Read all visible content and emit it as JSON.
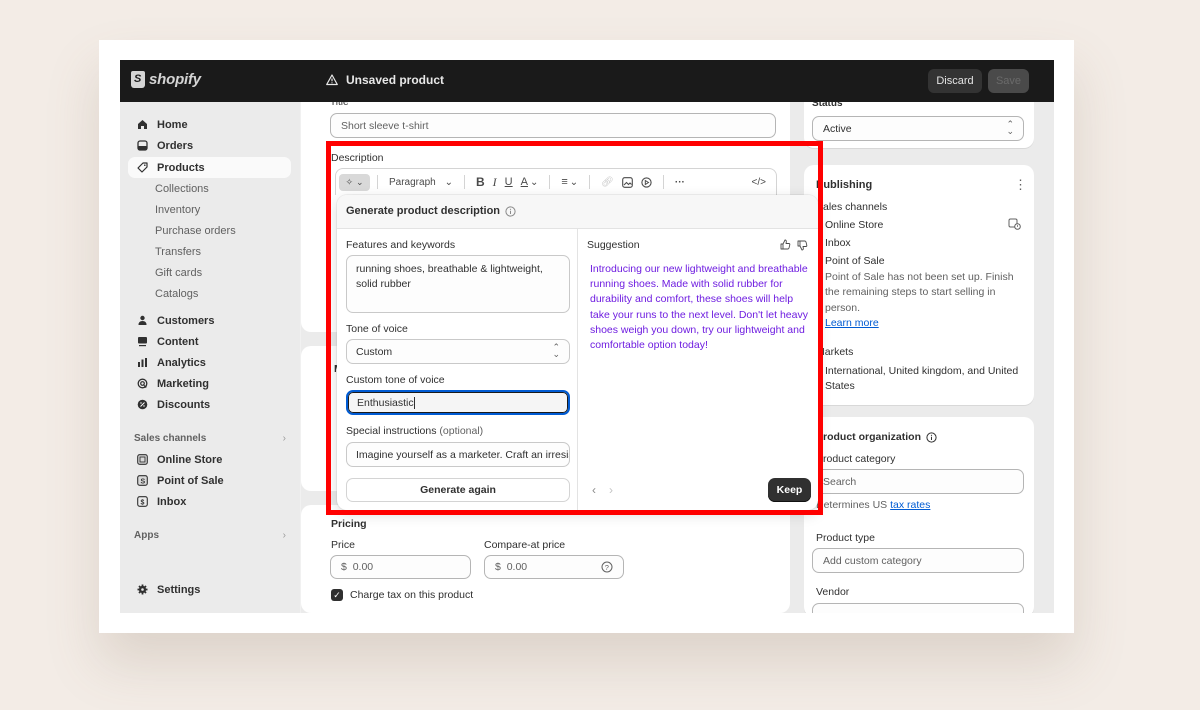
{
  "app": {
    "brand": "shopify",
    "page_status": "Unsaved product",
    "discard_label": "Discard",
    "save_label": "Save"
  },
  "sidebar": {
    "items": [
      {
        "label": "Home",
        "icon": "home-icon"
      },
      {
        "label": "Orders",
        "icon": "orders-icon"
      },
      {
        "label": "Products",
        "icon": "tag-icon",
        "active": true
      }
    ],
    "product_subitems": [
      "Collections",
      "Inventory",
      "Purchase orders",
      "Transfers",
      "Gift cards",
      "Catalogs"
    ],
    "items2": [
      {
        "label": "Customers",
        "icon": "person-icon"
      },
      {
        "label": "Content",
        "icon": "content-icon"
      },
      {
        "label": "Analytics",
        "icon": "bar-chart-icon"
      },
      {
        "label": "Marketing",
        "icon": "target-icon"
      },
      {
        "label": "Discounts",
        "icon": "discount-icon"
      }
    ],
    "sales_channels_label": "Sales channels",
    "channels": [
      {
        "label": "Online Store",
        "icon": "store-icon"
      },
      {
        "label": "Point of Sale",
        "icon": "pos-icon"
      },
      {
        "label": "Inbox",
        "icon": "inbox-icon"
      }
    ],
    "apps_label": "Apps",
    "settings_label": "Settings"
  },
  "main": {
    "title_label": "Title",
    "title_value": "Short sleeve t-shirt",
    "description_label": "Description",
    "toolbar": {
      "paragraph_label": "Paragraph"
    },
    "pricing": {
      "heading": "Pricing",
      "price_label": "Price",
      "price_currency": "$",
      "price_value": "0.00",
      "compare_label": "Compare-at price",
      "compare_currency": "$",
      "compare_value": "0.00",
      "charge_tax_label": "Charge tax on this product",
      "charge_tax_checked": true
    }
  },
  "popover": {
    "title": "Generate product description",
    "features_label": "Features and keywords",
    "features_value": "running shoes, breathable & lightweight, solid rubber",
    "tone_label": "Tone of voice",
    "tone_value": "Custom",
    "custom_tone_label": "Custom tone of voice",
    "custom_tone_value": "Enthusiastic",
    "special_label": "Special instructions",
    "special_optional": "(optional)",
    "special_value": "Imagine yourself as a marketer. Craft an irresistible",
    "generate_again_label": "Generate again",
    "suggestion_label": "Suggestion",
    "suggestion_text": "Introducing our new lightweight and breathable running shoes. Made with solid rubber for durability and comfort, these shoes will help take your runs to the next level. Don't let heavy shoes weigh you down, try our lightweight and comfortable option today!",
    "keep_label": "Keep"
  },
  "right": {
    "status_label": "Status",
    "status_value": "Active",
    "publishing_heading": "Publishing",
    "sales_channels_label": "Sales channels",
    "channels": [
      "Online Store",
      "Inbox",
      "Point of Sale"
    ],
    "pos_note": "Point of Sale has not been set up. Finish the remaining steps to start selling in person.",
    "learn_more": "Learn more",
    "markets_label": "Markets",
    "markets_value": "International, United kingdom, and United States",
    "org_heading": "Product organization",
    "category_label": "Product category",
    "category_placeholder": "Search",
    "category_help_prefix": "Determines US",
    "category_help_link": "tax rates",
    "type_label": "Product type",
    "type_placeholder": "Add custom category",
    "vendor_label": "Vendor"
  },
  "colors": {
    "highlight_box": "#ff0000",
    "suggestion_text": "#6e1ce0",
    "focus_ring": "#005bd3",
    "topbar": "#1a1a1a"
  }
}
